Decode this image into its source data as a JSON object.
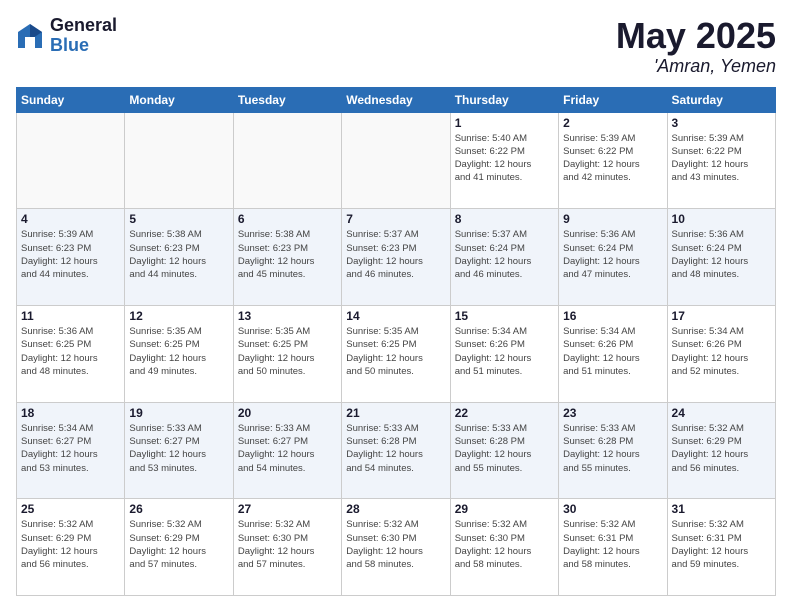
{
  "logo": {
    "general": "General",
    "blue": "Blue"
  },
  "title": {
    "month_year": "May 2025",
    "location": "'Amran, Yemen"
  },
  "days_of_week": [
    "Sunday",
    "Monday",
    "Tuesday",
    "Wednesday",
    "Thursday",
    "Friday",
    "Saturday"
  ],
  "weeks": [
    [
      {
        "day": "",
        "info": ""
      },
      {
        "day": "",
        "info": ""
      },
      {
        "day": "",
        "info": ""
      },
      {
        "day": "",
        "info": ""
      },
      {
        "day": "1",
        "info": "Sunrise: 5:40 AM\nSunset: 6:22 PM\nDaylight: 12 hours\nand 41 minutes."
      },
      {
        "day": "2",
        "info": "Sunrise: 5:39 AM\nSunset: 6:22 PM\nDaylight: 12 hours\nand 42 minutes."
      },
      {
        "day": "3",
        "info": "Sunrise: 5:39 AM\nSunset: 6:22 PM\nDaylight: 12 hours\nand 43 minutes."
      }
    ],
    [
      {
        "day": "4",
        "info": "Sunrise: 5:39 AM\nSunset: 6:23 PM\nDaylight: 12 hours\nand 44 minutes."
      },
      {
        "day": "5",
        "info": "Sunrise: 5:38 AM\nSunset: 6:23 PM\nDaylight: 12 hours\nand 44 minutes."
      },
      {
        "day": "6",
        "info": "Sunrise: 5:38 AM\nSunset: 6:23 PM\nDaylight: 12 hours\nand 45 minutes."
      },
      {
        "day": "7",
        "info": "Sunrise: 5:37 AM\nSunset: 6:23 PM\nDaylight: 12 hours\nand 46 minutes."
      },
      {
        "day": "8",
        "info": "Sunrise: 5:37 AM\nSunset: 6:24 PM\nDaylight: 12 hours\nand 46 minutes."
      },
      {
        "day": "9",
        "info": "Sunrise: 5:36 AM\nSunset: 6:24 PM\nDaylight: 12 hours\nand 47 minutes."
      },
      {
        "day": "10",
        "info": "Sunrise: 5:36 AM\nSunset: 6:24 PM\nDaylight: 12 hours\nand 48 minutes."
      }
    ],
    [
      {
        "day": "11",
        "info": "Sunrise: 5:36 AM\nSunset: 6:25 PM\nDaylight: 12 hours\nand 48 minutes."
      },
      {
        "day": "12",
        "info": "Sunrise: 5:35 AM\nSunset: 6:25 PM\nDaylight: 12 hours\nand 49 minutes."
      },
      {
        "day": "13",
        "info": "Sunrise: 5:35 AM\nSunset: 6:25 PM\nDaylight: 12 hours\nand 50 minutes."
      },
      {
        "day": "14",
        "info": "Sunrise: 5:35 AM\nSunset: 6:25 PM\nDaylight: 12 hours\nand 50 minutes."
      },
      {
        "day": "15",
        "info": "Sunrise: 5:34 AM\nSunset: 6:26 PM\nDaylight: 12 hours\nand 51 minutes."
      },
      {
        "day": "16",
        "info": "Sunrise: 5:34 AM\nSunset: 6:26 PM\nDaylight: 12 hours\nand 51 minutes."
      },
      {
        "day": "17",
        "info": "Sunrise: 5:34 AM\nSunset: 6:26 PM\nDaylight: 12 hours\nand 52 minutes."
      }
    ],
    [
      {
        "day": "18",
        "info": "Sunrise: 5:34 AM\nSunset: 6:27 PM\nDaylight: 12 hours\nand 53 minutes."
      },
      {
        "day": "19",
        "info": "Sunrise: 5:33 AM\nSunset: 6:27 PM\nDaylight: 12 hours\nand 53 minutes."
      },
      {
        "day": "20",
        "info": "Sunrise: 5:33 AM\nSunset: 6:27 PM\nDaylight: 12 hours\nand 54 minutes."
      },
      {
        "day": "21",
        "info": "Sunrise: 5:33 AM\nSunset: 6:28 PM\nDaylight: 12 hours\nand 54 minutes."
      },
      {
        "day": "22",
        "info": "Sunrise: 5:33 AM\nSunset: 6:28 PM\nDaylight: 12 hours\nand 55 minutes."
      },
      {
        "day": "23",
        "info": "Sunrise: 5:33 AM\nSunset: 6:28 PM\nDaylight: 12 hours\nand 55 minutes."
      },
      {
        "day": "24",
        "info": "Sunrise: 5:32 AM\nSunset: 6:29 PM\nDaylight: 12 hours\nand 56 minutes."
      }
    ],
    [
      {
        "day": "25",
        "info": "Sunrise: 5:32 AM\nSunset: 6:29 PM\nDaylight: 12 hours\nand 56 minutes."
      },
      {
        "day": "26",
        "info": "Sunrise: 5:32 AM\nSunset: 6:29 PM\nDaylight: 12 hours\nand 57 minutes."
      },
      {
        "day": "27",
        "info": "Sunrise: 5:32 AM\nSunset: 6:30 PM\nDaylight: 12 hours\nand 57 minutes."
      },
      {
        "day": "28",
        "info": "Sunrise: 5:32 AM\nSunset: 6:30 PM\nDaylight: 12 hours\nand 58 minutes."
      },
      {
        "day": "29",
        "info": "Sunrise: 5:32 AM\nSunset: 6:30 PM\nDaylight: 12 hours\nand 58 minutes."
      },
      {
        "day": "30",
        "info": "Sunrise: 5:32 AM\nSunset: 6:31 PM\nDaylight: 12 hours\nand 58 minutes."
      },
      {
        "day": "31",
        "info": "Sunrise: 5:32 AM\nSunset: 6:31 PM\nDaylight: 12 hours\nand 59 minutes."
      }
    ]
  ]
}
